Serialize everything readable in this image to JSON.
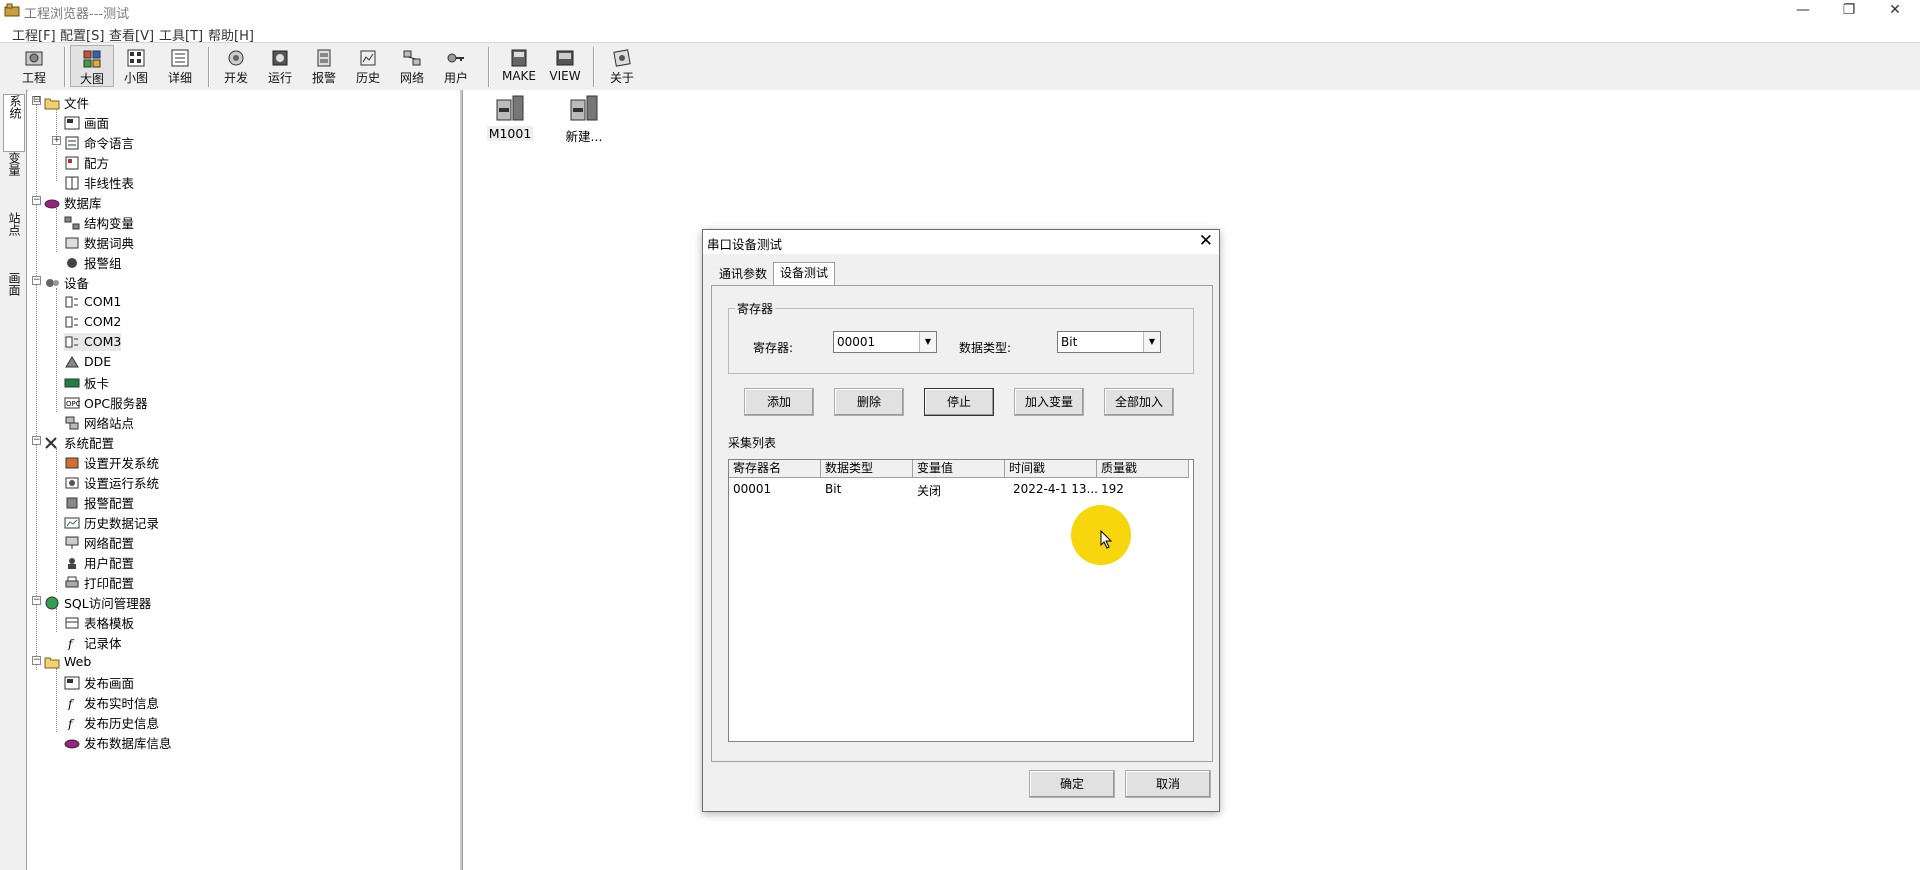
{
  "window": {
    "title": "工程浏览器---测试",
    "controls": {
      "minimize": "—",
      "maximize": "❐",
      "close": "✕"
    }
  },
  "menu": [
    "工程[F]",
    "配置[S]",
    "查看[V]",
    "工具[T]",
    "帮助[H]"
  ],
  "toolbar": [
    {
      "label": "工程",
      "icon": "project-icon"
    },
    {
      "label": "大图",
      "icon": "large-icons-icon"
    },
    {
      "label": "小图",
      "icon": "small-icons-icon"
    },
    {
      "label": "详细",
      "icon": "details-icon"
    },
    {
      "label": "开发",
      "icon": "develop-icon"
    },
    {
      "label": "运行",
      "icon": "run-icon"
    },
    {
      "label": "报警",
      "icon": "alarm-icon"
    },
    {
      "label": "历史",
      "icon": "history-icon"
    },
    {
      "label": "网络",
      "icon": "network-icon"
    },
    {
      "label": "用户",
      "icon": "user-key-icon"
    },
    {
      "label": "MAKE",
      "icon": "make-icon"
    },
    {
      "label": "VIEW",
      "icon": "view-icon"
    },
    {
      "label": "关于",
      "icon": "about-icon"
    }
  ],
  "vtabs": [
    "系统",
    "变量",
    "站点",
    "画面"
  ],
  "tree": [
    {
      "label": "文件",
      "level": 0,
      "icon": "folder-icon",
      "expander": "⊟"
    },
    {
      "label": "画面",
      "level": 1,
      "icon": "screen-icon"
    },
    {
      "label": "命令语言",
      "level": 1,
      "icon": "command-icon",
      "expander": "+"
    },
    {
      "label": "配方",
      "level": 1,
      "icon": "recipe-icon"
    },
    {
      "label": "非线性表",
      "level": 1,
      "icon": "table-icon"
    },
    {
      "label": "数据库",
      "level": 0,
      "icon": "database-icon",
      "expander": "−"
    },
    {
      "label": "结构变量",
      "level": 1,
      "icon": "struct-var-icon"
    },
    {
      "label": "数据词典",
      "level": 1,
      "icon": "dictionary-icon"
    },
    {
      "label": "报警组",
      "level": 1,
      "icon": "alarm-group-icon"
    },
    {
      "label": "设备",
      "level": 0,
      "icon": "device-icon",
      "expander": "−"
    },
    {
      "label": "COM1",
      "level": 1,
      "icon": "com-port-icon"
    },
    {
      "label": "COM2",
      "level": 1,
      "icon": "com-port-icon"
    },
    {
      "label": "COM3",
      "level": 1,
      "icon": "com-port-icon"
    },
    {
      "label": "DDE",
      "level": 1,
      "icon": "dde-icon"
    },
    {
      "label": "板卡",
      "level": 1,
      "icon": "board-card-icon"
    },
    {
      "label": "OPC服务器",
      "level": 1,
      "icon": "opc-icon"
    },
    {
      "label": "网络站点",
      "level": 1,
      "icon": "network-station-icon"
    },
    {
      "label": "系统配置",
      "level": 0,
      "icon": "tools-icon",
      "expander": "−"
    },
    {
      "label": "设置开发系统",
      "level": 1,
      "icon": "dev-settings-icon"
    },
    {
      "label": "设置运行系统",
      "level": 1,
      "icon": "run-settings-icon"
    },
    {
      "label": "报警配置",
      "level": 1,
      "icon": "alarm-config-icon"
    },
    {
      "label": "历史数据记录",
      "level": 1,
      "icon": "history-record-icon"
    },
    {
      "label": "网络配置",
      "level": 1,
      "icon": "network-config-icon"
    },
    {
      "label": "用户配置",
      "level": 1,
      "icon": "user-config-icon"
    },
    {
      "label": "打印配置",
      "level": 1,
      "icon": "print-config-icon"
    },
    {
      "label": "SQL访问管理器",
      "level": 0,
      "icon": "sql-icon",
      "expander": "−"
    },
    {
      "label": "表格模板",
      "level": 1,
      "icon": "table-template-icon"
    },
    {
      "label": "记录体",
      "level": 1,
      "icon": "record-icon"
    },
    {
      "label": "Web",
      "level": 0,
      "icon": "folder-icon",
      "expander": "−"
    },
    {
      "label": "发布画面",
      "level": 1,
      "icon": "publish-screen-icon"
    },
    {
      "label": "发布实时信息",
      "level": 1,
      "icon": "publish-realtime-icon"
    },
    {
      "label": "发布历史信息",
      "level": 1,
      "icon": "publish-history-icon"
    },
    {
      "label": "发布数据库信息",
      "level": 1,
      "icon": "publish-database-icon"
    }
  ],
  "main_icons": [
    {
      "label": "M1001",
      "icon": "screen-file-icon"
    },
    {
      "label": "新建...",
      "icon": "new-screen-icon"
    }
  ],
  "dialog": {
    "title": "串口设备测试",
    "close": "✕",
    "tabs": [
      "通讯参数",
      "设备测试"
    ],
    "active_tab": 1,
    "group_title": "寄存器",
    "register_label": "寄存器:",
    "register_value": "00001",
    "datatype_label": "数据类型:",
    "datatype_value": "Bit",
    "buttons": [
      "添加",
      "删除",
      "停止",
      "加入变量",
      "全部加入"
    ],
    "list_label": "采集列表",
    "columns": [
      "寄存器名",
      "数据类型",
      "变量值",
      "时间戳",
      "质量戳"
    ],
    "rows": [
      [
        "00001",
        "Bit",
        "关闭",
        "2022-4-1 13...",
        "192"
      ]
    ],
    "ok": "确定",
    "cancel": "取消"
  }
}
